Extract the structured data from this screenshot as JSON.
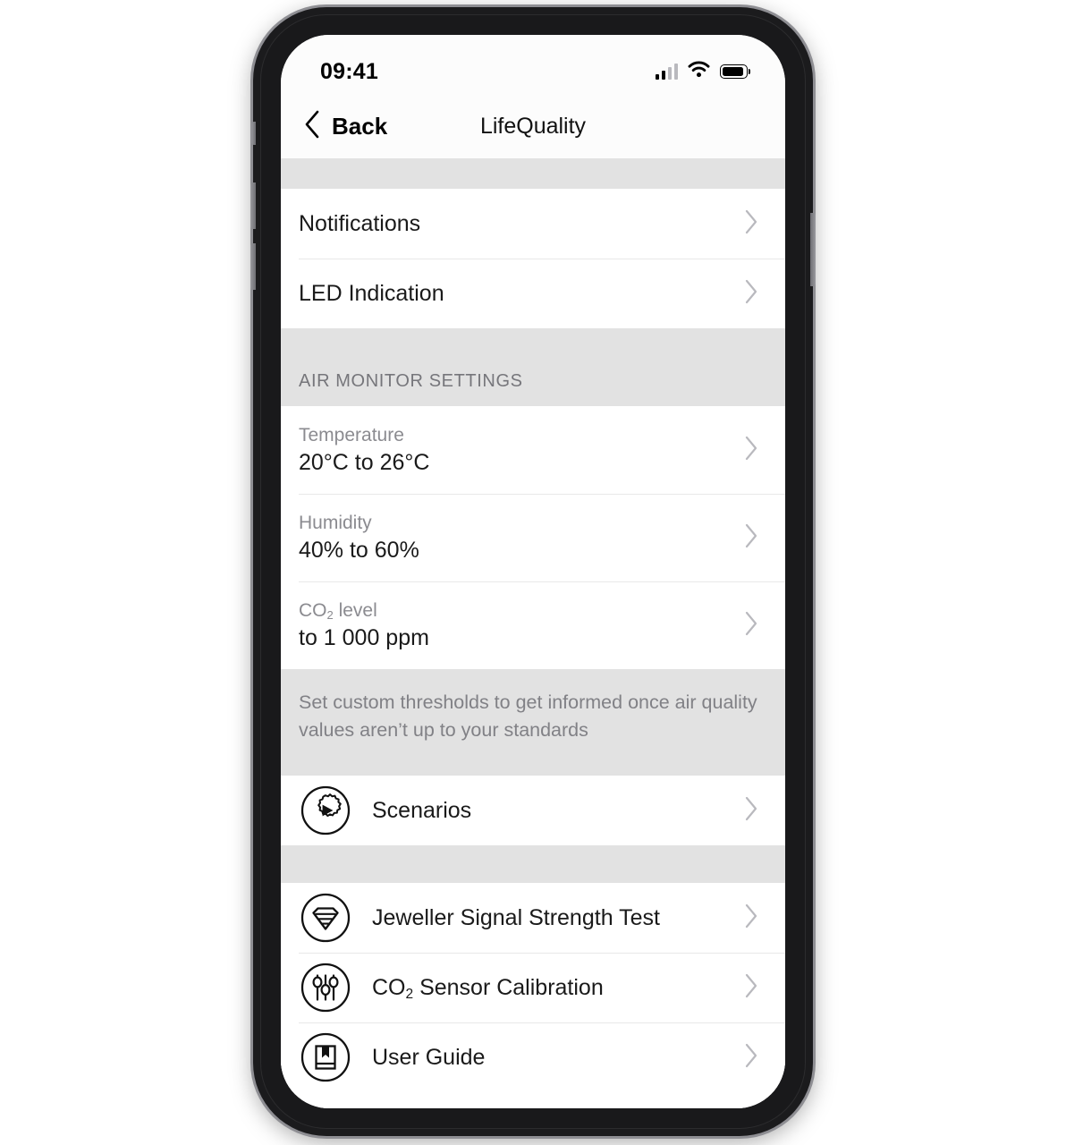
{
  "status_bar": {
    "time": "09:41",
    "cellular_icon": "cellular-signal-icon",
    "wifi_icon": "wifi-icon",
    "battery_icon": "battery-full-icon"
  },
  "nav": {
    "back_label": "Back",
    "back_icon": "chevron-left-icon",
    "title": "LifeQuality"
  },
  "list": {
    "top_rows": [
      {
        "label": "Notifications",
        "icon": "chevron-right-icon"
      },
      {
        "label": "LED Indication",
        "icon": "chevron-right-icon"
      }
    ],
    "air_section_header": "AIR MONITOR SETTINGS",
    "air_rows": [
      {
        "label": "Temperature",
        "value": "20°C to 26°C"
      },
      {
        "label": "Humidity",
        "value": "40% to 60%"
      },
      {
        "label_prefix": "CO",
        "label_sub": "2",
        "label_suffix": " level",
        "value": "to 1 000 ppm"
      }
    ],
    "air_footer_note": "Set custom thresholds to get informed once air quality values aren’t up to your standards",
    "scenarios_row": {
      "label": "Scenarios",
      "icon": "gear-play-icon"
    },
    "tools_rows": [
      {
        "label": "Jeweller Signal Strength Test",
        "icon": "jeweller-signal-icon"
      },
      {
        "label_prefix": "CO",
        "label_sub": "2",
        "label_suffix": " Sensor Calibration",
        "icon": "sliders-icon"
      },
      {
        "label": "User Guide",
        "icon": "book-bookmark-icon"
      }
    ]
  },
  "colors": {
    "section_band": "#e2e2e2",
    "row_background": "#ffffff",
    "primary_text": "#1a1a1a",
    "secondary_text": "#8b8b90",
    "chevron": "#b9b9be",
    "frame": "#1b1b1d"
  },
  "home_indicator": "home-indicator"
}
